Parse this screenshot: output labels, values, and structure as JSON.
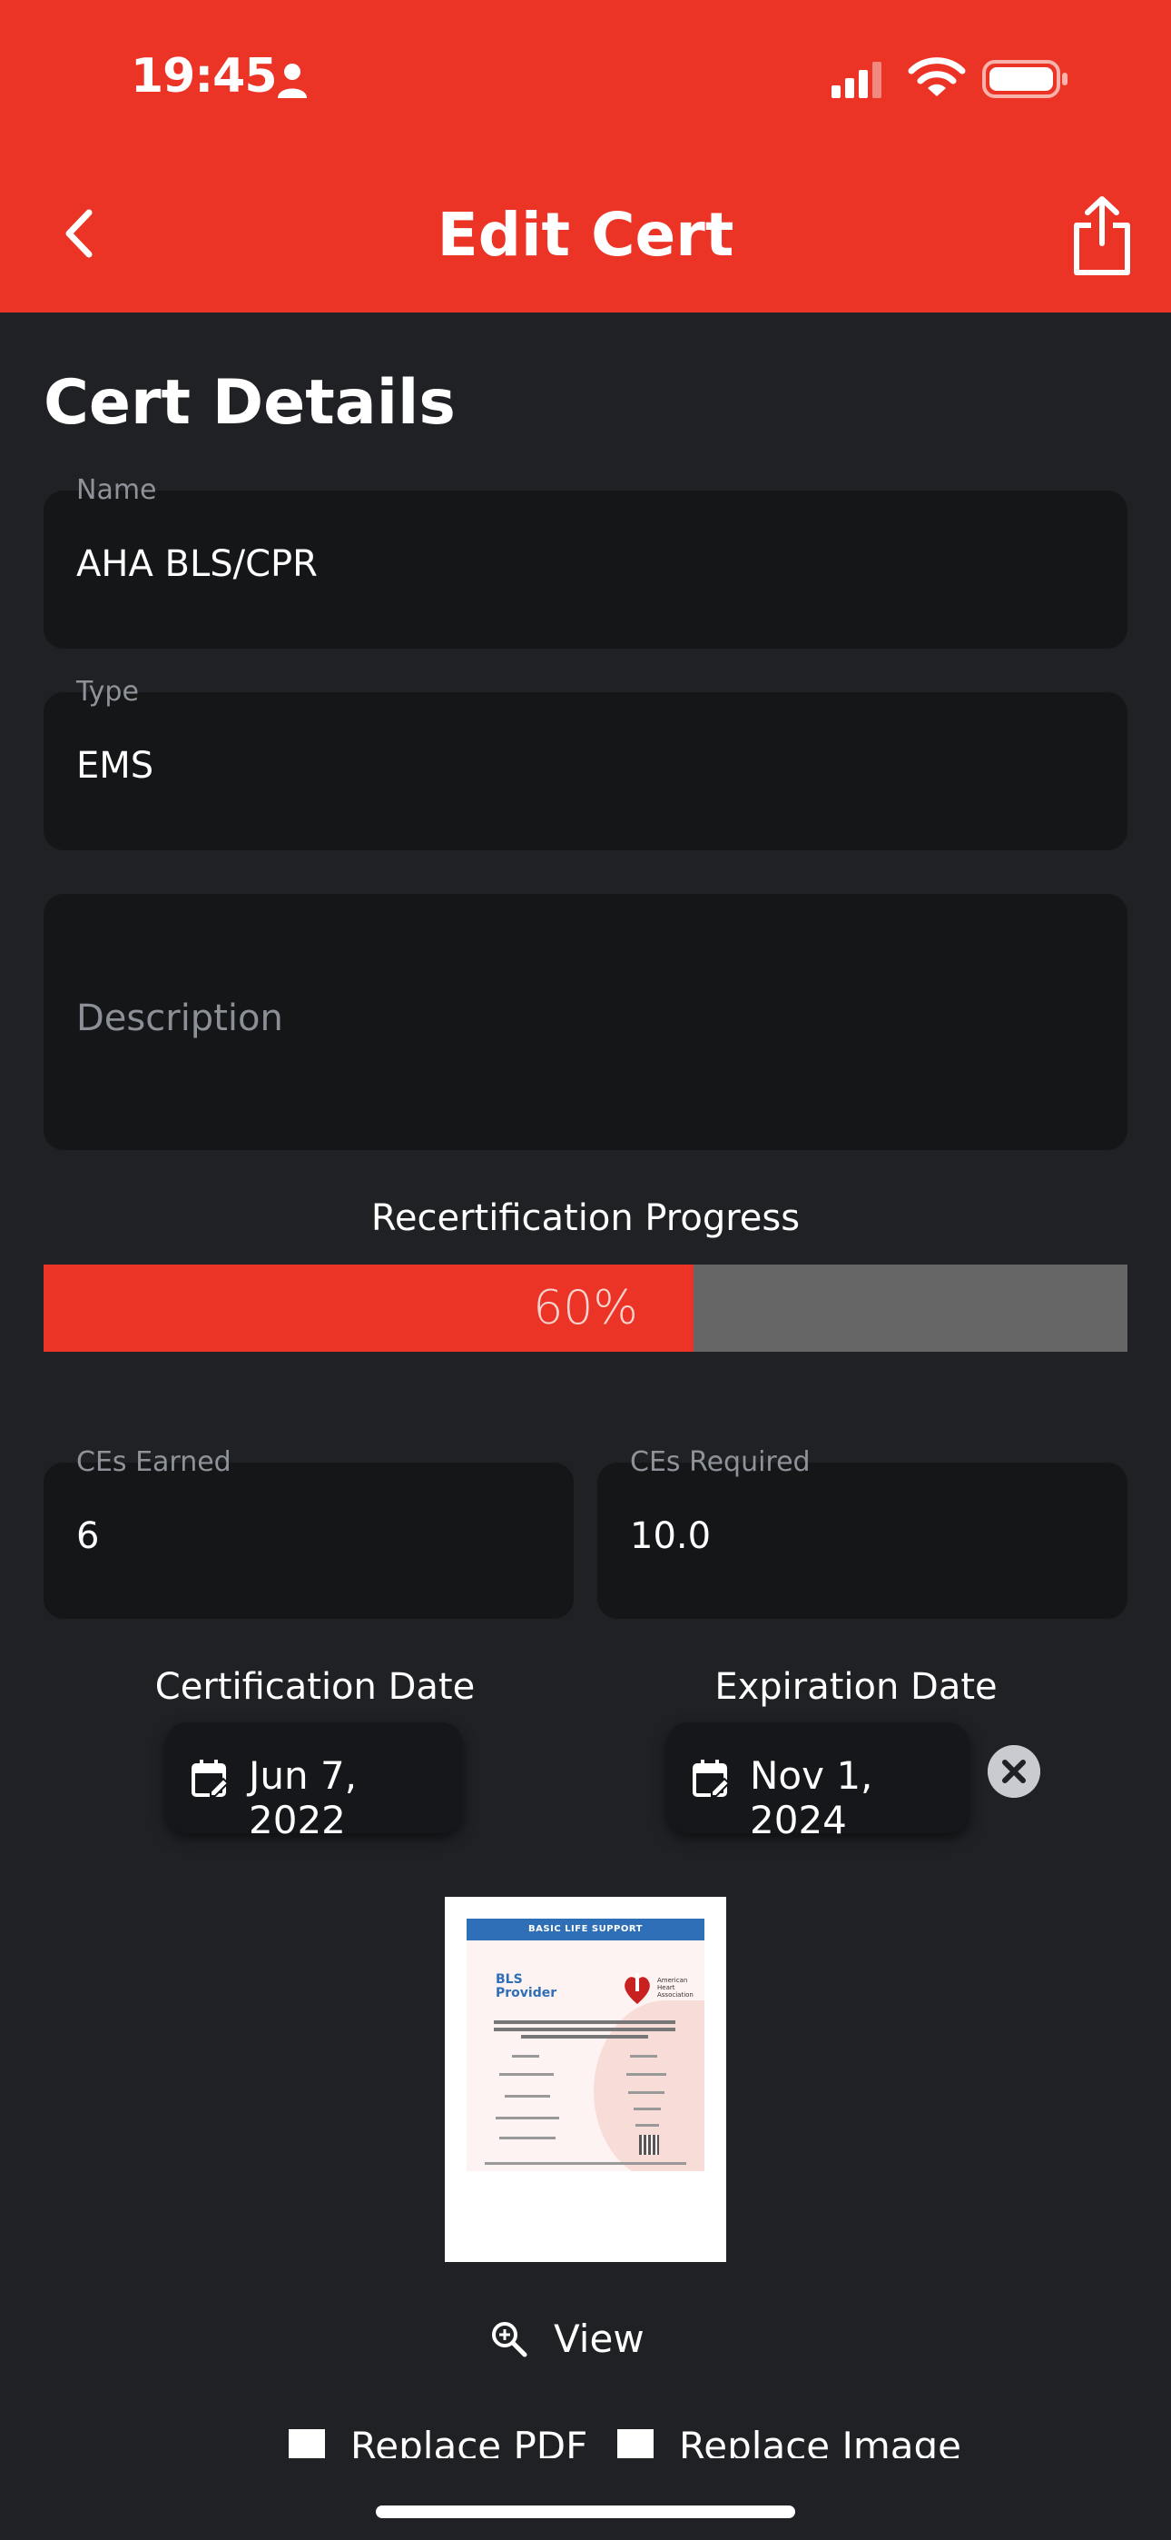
{
  "status_bar": {
    "time": "19:45"
  },
  "nav": {
    "title": "Edit Cert"
  },
  "section_title": "Cert Details",
  "fields": {
    "name": {
      "label": "Name",
      "value": "AHA BLS/CPR"
    },
    "type": {
      "label": "Type",
      "value": "EMS"
    },
    "description": {
      "placeholder": "Description"
    }
  },
  "progress": {
    "title": "Recertification Progress",
    "percent_text": "60%",
    "value": 0.6
  },
  "ces": {
    "earned": {
      "label": "CEs Earned",
      "value": "6"
    },
    "required": {
      "label": "CEs Required",
      "value": "10.0"
    }
  },
  "dates": {
    "certification": {
      "label": "Certification Date",
      "value": "Jun 7, 2022"
    },
    "expiration": {
      "label": "Expiration Date",
      "value": "Nov 1, 2024"
    }
  },
  "certificate": {
    "banner": "BASIC LIFE SUPPORT",
    "provider": "BLS Provider",
    "org": "American Heart Association"
  },
  "actions": {
    "view": "View",
    "replace_pdf": "Replace PDF",
    "replace_image": "Replace Image"
  },
  "colors": {
    "accent": "#eb3426",
    "background": "#1f2125",
    "field": "#151618",
    "track": "#666666"
  }
}
